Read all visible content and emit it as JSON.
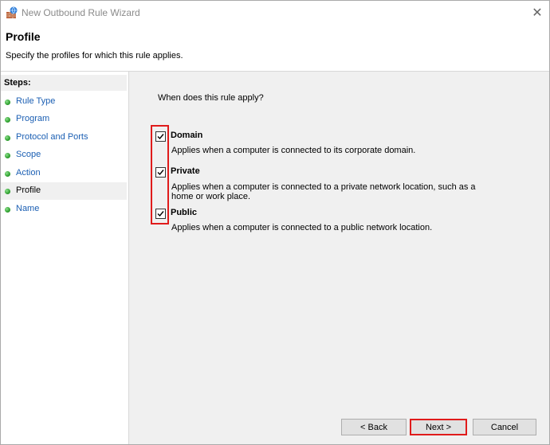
{
  "window": {
    "title": "New Outbound Rule Wizard",
    "close_glyph": "✕"
  },
  "header": {
    "title": "Profile",
    "subtitle": "Specify the profiles for which this rule applies."
  },
  "sidebar": {
    "steps_label": "Steps:",
    "items": [
      {
        "label": "Rule Type"
      },
      {
        "label": "Program"
      },
      {
        "label": "Protocol and Ports"
      },
      {
        "label": "Scope"
      },
      {
        "label": "Action"
      },
      {
        "label": "Profile",
        "selected": true
      },
      {
        "label": "Name"
      }
    ]
  },
  "content": {
    "question": "When does this rule apply?",
    "profiles": [
      {
        "label": "Domain",
        "checked": true,
        "description": "Applies when a computer is connected to its corporate domain."
      },
      {
        "label": "Private",
        "checked": true,
        "description": "Applies when a computer is connected to a private network location, such as a home or work place."
      },
      {
        "label": "Public",
        "checked": true,
        "description": "Applies when a computer is connected to a public network location."
      }
    ]
  },
  "buttons": {
    "back": "< Back",
    "next": "Next >",
    "cancel": "Cancel"
  },
  "colors": {
    "highlight": "#e01b1b",
    "link": "#1b5fb3",
    "step_dot": "#2fa12f"
  }
}
